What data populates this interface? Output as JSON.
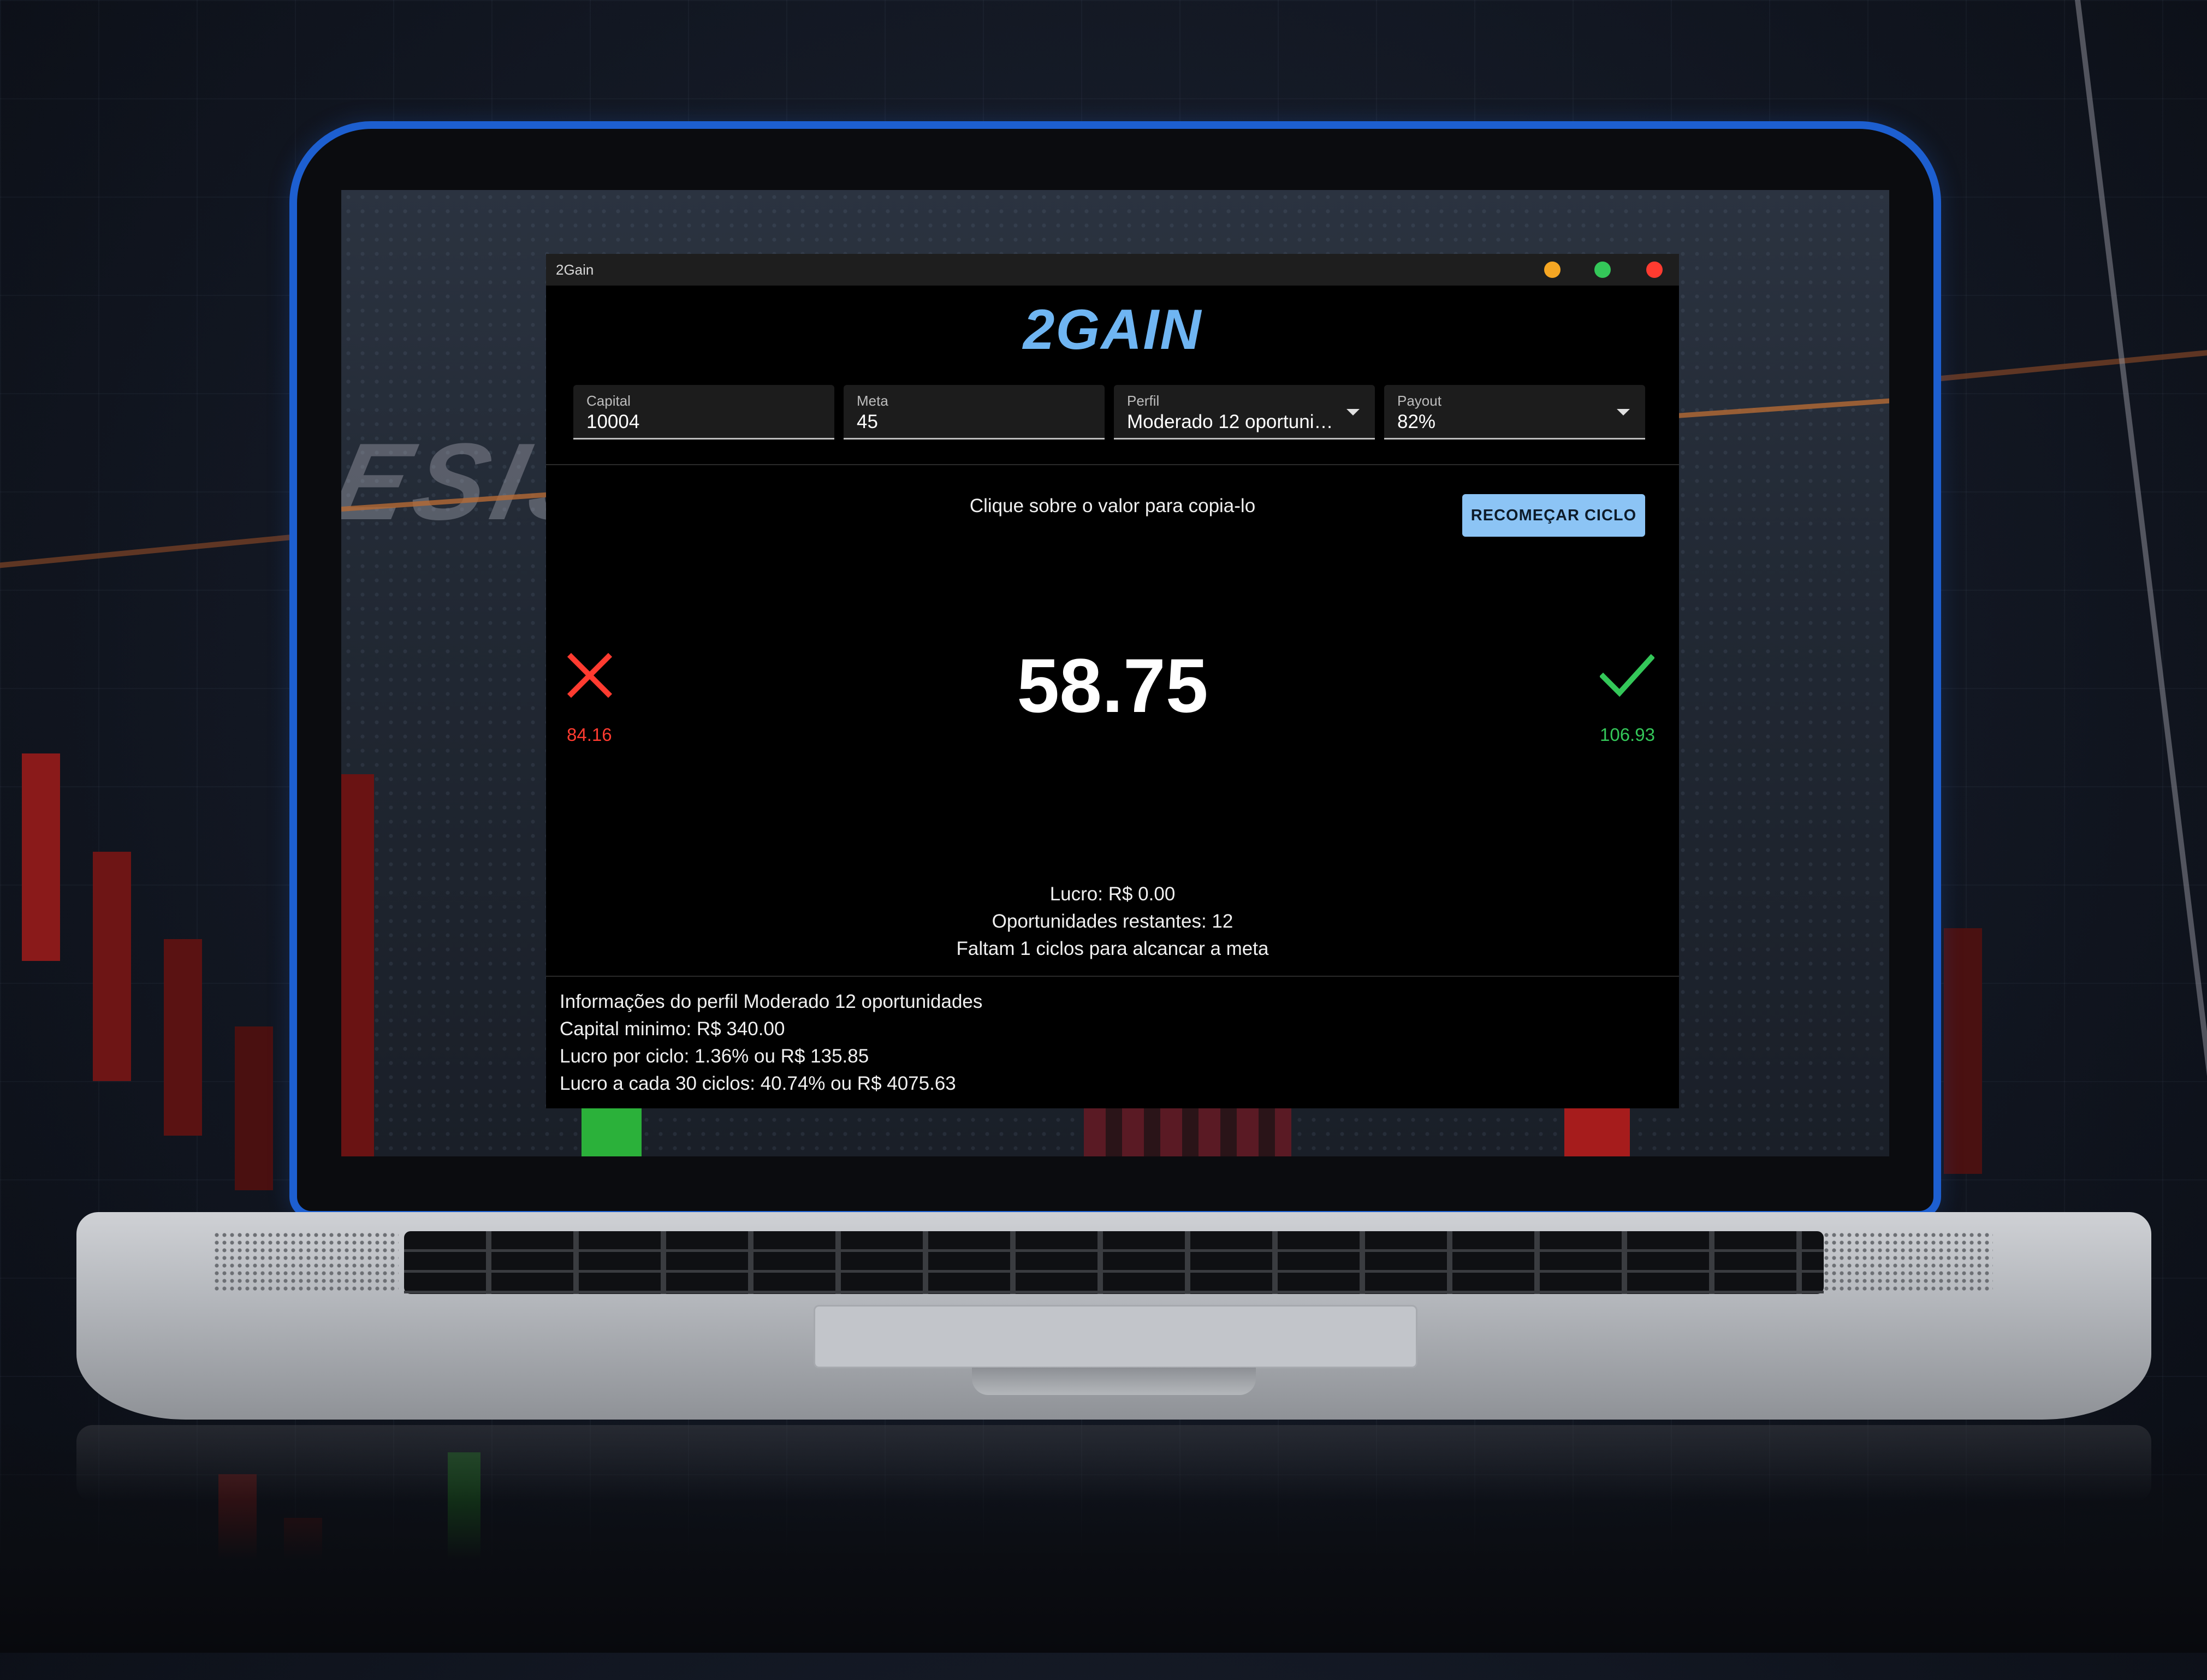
{
  "window": {
    "title": "2Gain",
    "controls": {
      "minimize_color": "#f5a623",
      "maximize_color": "#34c759",
      "close_color": "#ff3b30"
    }
  },
  "app": {
    "brand": "2GAIN",
    "brand_color": "#6fb5f2"
  },
  "form": {
    "capital": {
      "label": "Capital",
      "value": "10004"
    },
    "meta": {
      "label": "Meta",
      "value": "45"
    },
    "perfil": {
      "label": "Perfil",
      "value": "Moderado 12 oportunid…"
    },
    "payout": {
      "label": "Payout",
      "value": "82%"
    }
  },
  "main": {
    "hint": "Clique sobre o valor para copia-lo",
    "restart_button": "RECOMEÇAR CICLO",
    "current_value": "58.75",
    "loss": {
      "icon": "close-icon",
      "value": "84.16",
      "color": "#ff3b30"
    },
    "win": {
      "icon": "check-icon",
      "value": "106.93",
      "color": "#34c759"
    }
  },
  "stats": {
    "lucro": "Lucro: R$ 0.00",
    "oportunidades": "Oportunidades restantes: 12",
    "ciclos": "Faltam 1 ciclos para alcancar a meta"
  },
  "profile_info": {
    "title": "Informações do perfil Moderado 12 oportunidades",
    "capital_minimo": "Capital minimo: R$ 340.00",
    "lucro_por_ciclo": "Lucro por ciclo: 1.36% ou R$ 135.85",
    "lucro_30_ciclos": "Lucro a cada 30 ciclos: 40.74% ou R$ 4075.63"
  }
}
